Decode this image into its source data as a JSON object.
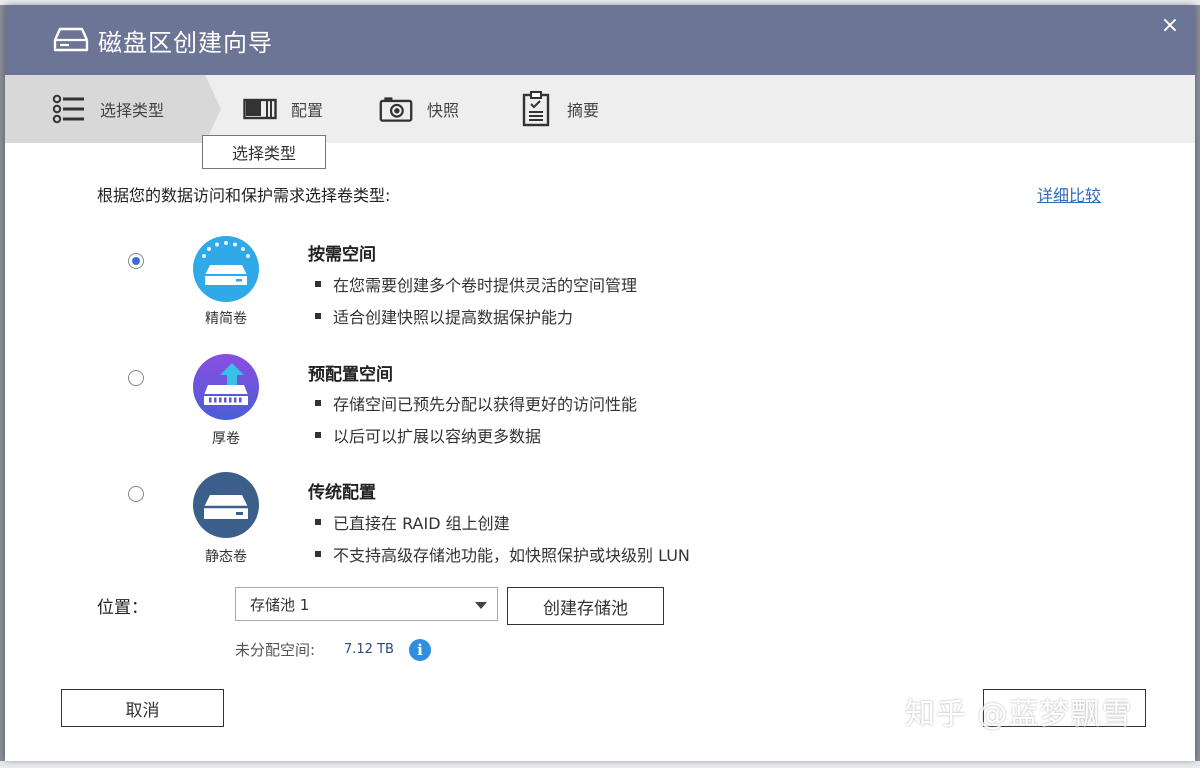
{
  "window": {
    "title": "磁盘区创建向导",
    "close_glyph": "×"
  },
  "steps": [
    {
      "label": "选择类型",
      "icon": "list-icon",
      "active": true
    },
    {
      "label": "配置",
      "icon": "config-icon",
      "active": false
    },
    {
      "label": "快照",
      "icon": "camera-icon",
      "active": false
    },
    {
      "label": "摘要",
      "icon": "clipboard-icon",
      "active": false
    }
  ],
  "tooltip": "选择类型",
  "prompt": "根据您的数据访问和保护需求选择卷类型:",
  "compare_link": "详细比较",
  "options": [
    {
      "icon_label": "精简卷",
      "title": "按需空间",
      "bullets": [
        "在您需要创建多个卷时提供灵活的空间管理",
        "适合创建快照以提高数据保护能力"
      ],
      "selected": true,
      "color": "#2fa9e8"
    },
    {
      "icon_label": "厚卷",
      "title": "预配置空间",
      "bullets": [
        "存储空间已预先分配以获得更好的访问性能",
        "以后可以扩展以容纳更多数据"
      ],
      "selected": false,
      "color": "#6a55d6"
    },
    {
      "icon_label": "静态卷",
      "title": "传统配置",
      "bullets": [
        "已直接在 RAID 组上创建",
        "不支持高级存储池功能，如快照保护或块级别 LUN"
      ],
      "selected": false,
      "color": "#3b5f8a"
    }
  ],
  "location": {
    "label": "位置：",
    "selected_pool": "存储池 1",
    "create_pool_button": "创建存储池",
    "unallocated_label": "未分配空间:",
    "unallocated_value": "7.12 TB"
  },
  "footer": {
    "cancel_button": "取消"
  },
  "watermark": "知乎 @蓝梦飘雪"
}
